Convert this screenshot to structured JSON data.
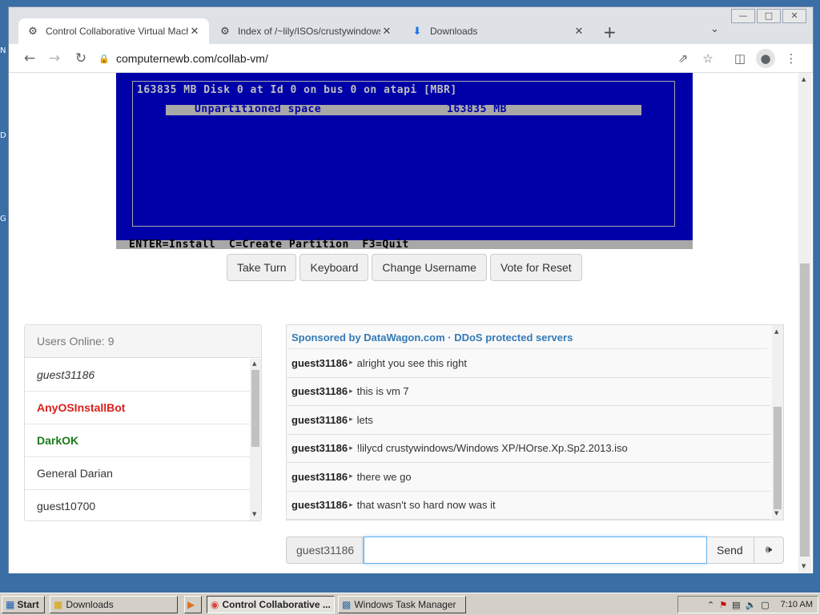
{
  "desktop": {
    "icon_letters": [
      "N",
      "D",
      "G"
    ]
  },
  "browser": {
    "tabs": [
      {
        "title": "Control Collaborative Virtual Machine",
        "icon": "vm-icon",
        "active": true
      },
      {
        "title": "Index of /~lily/ISOs/crustywindows/",
        "icon": "vm-icon",
        "active": false
      },
      {
        "title": "Downloads",
        "icon": "download-icon",
        "active": false
      }
    ],
    "url": "computernewb.com/collab-vm/"
  },
  "vm_screen": {
    "disk_line": "163835 MB Disk 0 at Id 0 on bus 0 on atapi [MBR]",
    "partition_label": "Unpartitioned space",
    "partition_size": "163835 MB",
    "status_bar": "ENTER=Install  C=Create Partition  F3=Quit",
    "colors": {
      "background": "#0000a8",
      "text": "#c0c0c0",
      "highlight": "#a8a8a8"
    }
  },
  "controls": {
    "take_turn": "Take Turn",
    "keyboard": "Keyboard",
    "change_username": "Change Username",
    "vote_reset": "Vote for Reset"
  },
  "users_panel": {
    "header": "Users Online: 9",
    "users": [
      {
        "name": "guest31186",
        "style": "italic",
        "color": "#333333"
      },
      {
        "name": "AnyOSInstallBot",
        "style": "bold",
        "color": "#d9201c"
      },
      {
        "name": "DarkOK",
        "style": "bold",
        "color": "#1b7a1b"
      },
      {
        "name": "General Darian",
        "style": "normal",
        "color": "#333333"
      },
      {
        "name": "guest10700",
        "style": "normal",
        "color": "#333333"
      }
    ]
  },
  "chat": {
    "banner": "Sponsored by DataWagon.com · DDoS protected servers",
    "messages": [
      {
        "user": "guest31186",
        "text": "alright you see this right"
      },
      {
        "user": "guest31186",
        "text": "this is vm 7"
      },
      {
        "user": "guest31186",
        "text": "lets"
      },
      {
        "user": "guest31186",
        "text": "!lilycd crustywindows/Windows XP/HOrse.Xp.Sp2.2013.iso"
      },
      {
        "user": "guest31186",
        "text": "there we go"
      },
      {
        "user": "guest31186",
        "text": "that wasn't so hard now was it"
      }
    ],
    "username": "guest31186",
    "input_value": "",
    "send_label": "Send"
  },
  "taskbar": {
    "start_label": "Start",
    "items": [
      {
        "label": "Downloads",
        "active": false
      },
      {
        "label": "Control Collaborative ...",
        "active": true
      },
      {
        "label": "Windows Task Manager",
        "active": false
      }
    ],
    "clock": "7:10 AM"
  }
}
